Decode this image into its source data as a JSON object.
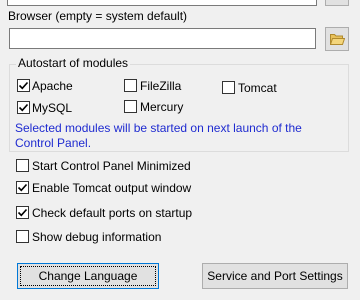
{
  "editor_field": {
    "value": ""
  },
  "browser": {
    "label": "Browser (empty = system default)",
    "value": ""
  },
  "icons": {
    "folder": "folder-open-icon",
    "ellipsis": "ellipsis-button-icon"
  },
  "autostart": {
    "title": "Autostart of modules",
    "modules": [
      {
        "label": "Apache",
        "checked": true
      },
      {
        "label": "FileZilla",
        "checked": false
      },
      {
        "label": "Tomcat",
        "checked": false
      },
      {
        "label": "MySQL",
        "checked": true
      },
      {
        "label": "Mercury",
        "checked": false
      }
    ],
    "note_line1": "Selected modules will be started on next launch of the",
    "note_line2": "Control Panel.",
    "note_color": "#1f2bd0"
  },
  "options": [
    {
      "label": "Start Control Panel Minimized",
      "checked": false
    },
    {
      "label": "Enable Tomcat output window",
      "checked": true
    },
    {
      "label": "Check default ports on startup",
      "checked": true
    },
    {
      "label": "Show debug information",
      "checked": false
    }
  ],
  "buttons": {
    "change_language": "Change Language",
    "service_port": "Service and Port Settings"
  }
}
